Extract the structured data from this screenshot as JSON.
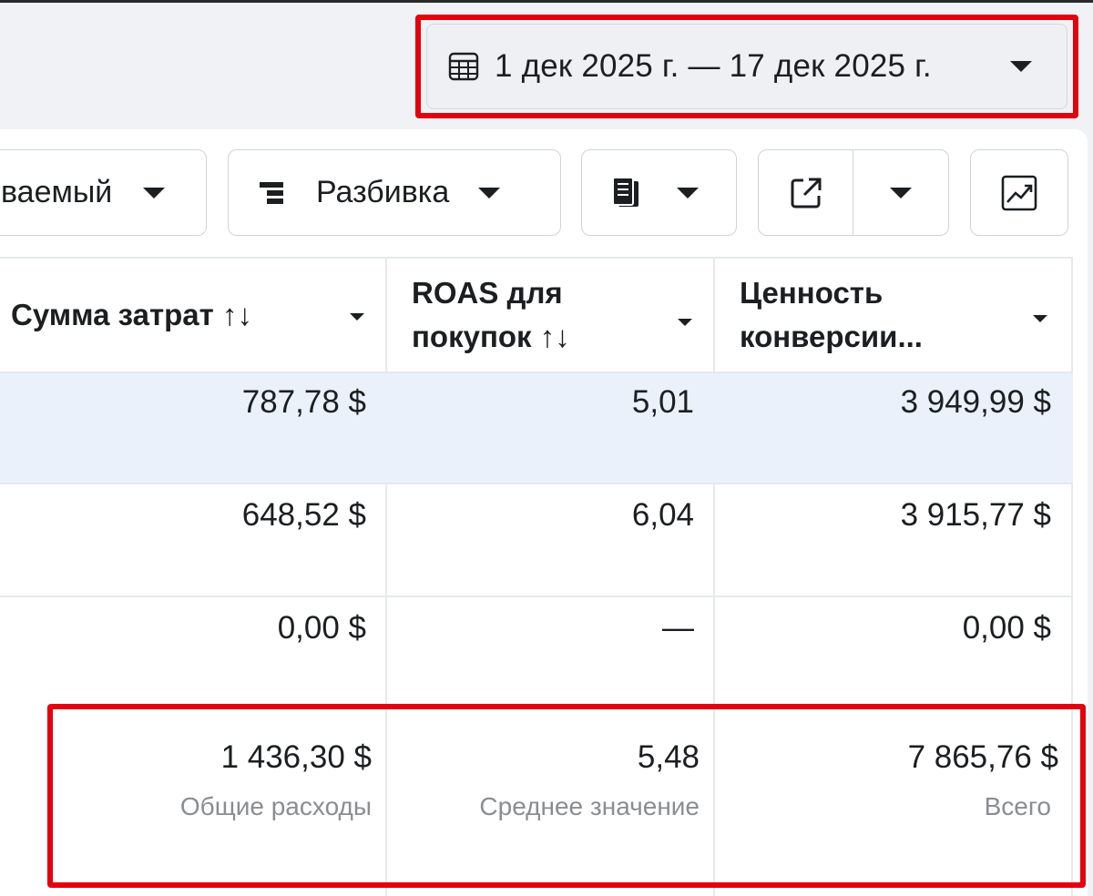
{
  "date_picker": {
    "range_label": "1 дек 2025 г. — 17 дек 2025 г.",
    "icon": "calendar-icon"
  },
  "toolbar": {
    "attribution_label": "ваемый",
    "breakdown_label": "Разбивка",
    "reports_icon": "reports-icon",
    "export_icon": "export-icon",
    "chart_icon": "chart-icon"
  },
  "table": {
    "columns": [
      {
        "label": "Сумма затрат ↑↓"
      },
      {
        "label_line1": "ROAS для",
        "label_line2": "покупок ↑↓"
      },
      {
        "label_line1": "Ценность",
        "label_line2": "конверсии..."
      }
    ],
    "rows": [
      {
        "spend": "787,78 $",
        "roas": "5,01",
        "value": "3 949,99 $",
        "selected": true
      },
      {
        "spend": "648,52 $",
        "roas": "6,04",
        "value": "3 915,77 $",
        "selected": false
      },
      {
        "spend": "0,00 $",
        "roas": "—",
        "value": "0,00 $",
        "selected": false
      }
    ],
    "totals": {
      "spend": "1 436,30 $",
      "spend_caption": "Общие расходы",
      "roas": "5,48",
      "roas_caption": "Среднее значение",
      "value": "7 865,76 $",
      "value_caption": "Всего"
    }
  },
  "colors": {
    "highlight": "#e3000f",
    "selected_row": "#eaf1fb",
    "page_bg": "#f0f2f5"
  }
}
